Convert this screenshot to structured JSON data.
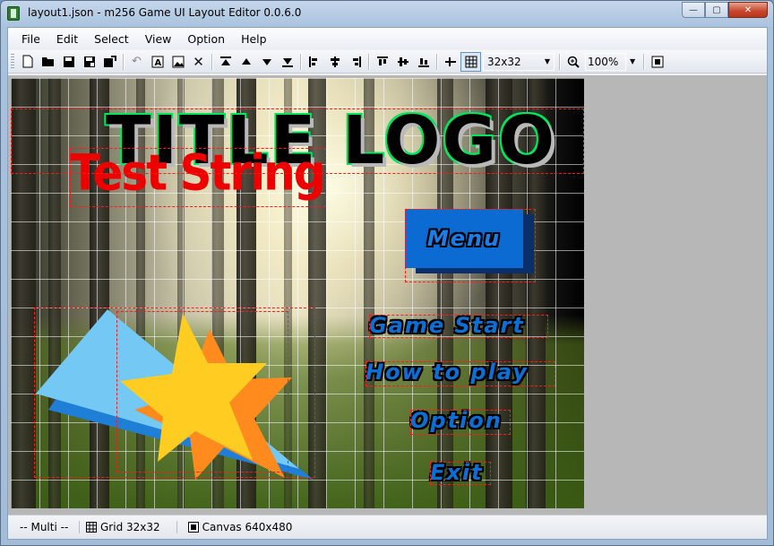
{
  "window": {
    "title": "layout1.json - m256 Game UI Layout Editor 0.0.6.0",
    "controls": {
      "minimize": "0",
      "maximize": "1",
      "close": "r"
    }
  },
  "menubar": {
    "items": [
      "File",
      "Edit",
      "Select",
      "View",
      "Option",
      "Help"
    ]
  },
  "toolbar": {
    "grid_size": "32x32",
    "zoom": "100%"
  },
  "canvas": {
    "logo_text": "TITLE LOGO",
    "test_string": "Test String",
    "menu_button": "Menu",
    "menu_labels": [
      "Game Start",
      "How to play",
      "Option",
      "Exit"
    ]
  },
  "statusbar": {
    "selection": "-- Multi --",
    "grid": "Grid 32x32",
    "canvas": "Canvas 640x480"
  },
  "colors": {
    "logo_green": "#00e65c",
    "test_red": "#ee0000",
    "button_blue": "#0c6ad3",
    "selection_red": "#ff1a1a",
    "star_yellow": "#ffcc22",
    "star_orange": "#ff8a1e",
    "wedge_lightblue": "#74c8f4",
    "wedge_darkblue": "#1f7fd6"
  }
}
